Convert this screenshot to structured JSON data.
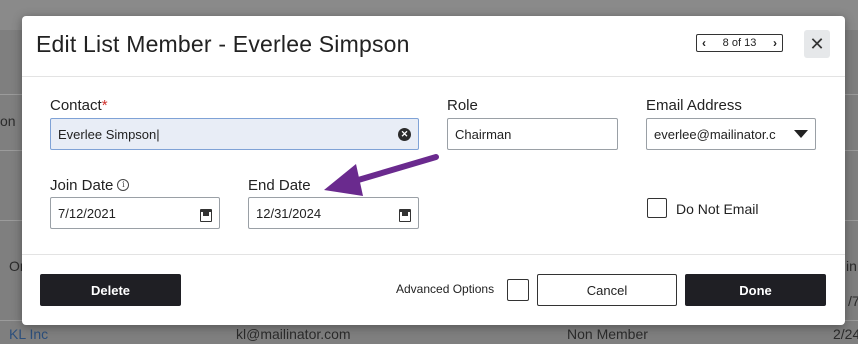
{
  "background": {
    "left_fragments": [
      "on",
      "Or"
    ],
    "right_fragments": [
      "in",
      "/7"
    ],
    "row": {
      "name": "KL Inc",
      "email": "kl@mailinator.com",
      "type": "Non Member",
      "date": "2/24"
    }
  },
  "modal": {
    "title": "Edit List Member - Everlee Simpson",
    "pager": {
      "prev_icon": "chevron-left-icon",
      "text": "8 of 13",
      "next_icon": "chevron-right-icon"
    },
    "close_icon": "close-icon"
  },
  "form": {
    "contact": {
      "label": "Contact",
      "required_mark": "*",
      "value": "Everlee Simpson"
    },
    "role": {
      "label": "Role",
      "value": "Chairman"
    },
    "email": {
      "label": "Email Address",
      "value": "everlee@mailinator.c"
    },
    "join_date": {
      "label": "Join Date",
      "info_icon": "info-icon",
      "value": "7/12/2021"
    },
    "end_date": {
      "label": "End Date",
      "value": "12/31/2024"
    },
    "do_not_email": {
      "label": "Do Not Email",
      "checked": false
    }
  },
  "footer": {
    "delete_label": "Delete",
    "advanced_options_label": "Advanced Options",
    "advanced_checked": false,
    "cancel_label": "Cancel",
    "done_label": "Done"
  },
  "colors": {
    "annotation_arrow": "#6a2a8e",
    "button_dark": "#1f1f24",
    "required": "#d0312d"
  }
}
